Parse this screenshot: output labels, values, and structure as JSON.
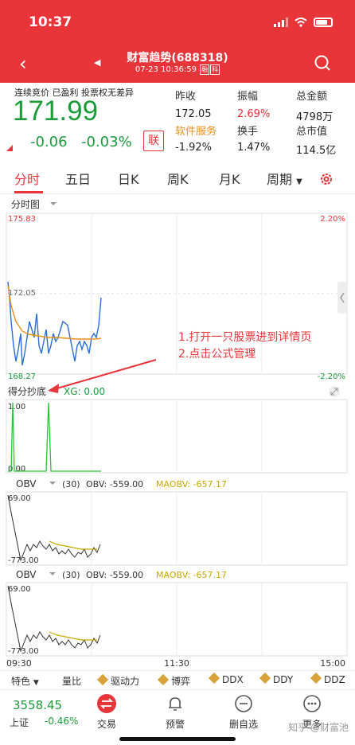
{
  "status_bar": {
    "time": "10:37"
  },
  "header": {
    "stock_name": "财富趋势",
    "stock_code": "(688318)",
    "datetime": "07-23 10:36:59",
    "tags": [
      "融",
      "科"
    ]
  },
  "quote": {
    "status_text": "连续竞价 已盈利 投票权无差异",
    "price": "171.99",
    "change": "-0.06",
    "change_pct": "-0.03%",
    "lian_label": "联",
    "fields": [
      {
        "label": "昨收",
        "value": "172.05"
      },
      {
        "label": "振幅",
        "value": "2.69%"
      },
      {
        "label": "总金额",
        "value": "4798万"
      },
      {
        "label": "软件服务",
        "value": "-1.92%"
      },
      {
        "label": "换手",
        "value": "1.47%"
      },
      {
        "label": "总市值",
        "value": "114.5亿"
      }
    ]
  },
  "tabs": [
    "分时",
    "五日",
    "日K",
    "周K",
    "月K",
    "周期"
  ],
  "chart": {
    "subtitle": "分时图",
    "y_max": "175.83",
    "y_mid": "172.05",
    "y_min": "168.27",
    "pct_max": "2.20%",
    "pct_min": "-2.20%",
    "annotation_line1": "1.打开一只股票进到详情页",
    "annotation_line2": "2.点击公式管理",
    "indicator1": {
      "name": "得分抄底",
      "xg": "XG: 0.00",
      "y_top": "1.00",
      "y_bottom": "0.00"
    },
    "obv1": {
      "name": "OBV",
      "params": "(30)",
      "obv": "OBV: -559.00",
      "maobv": "MAOBV: -657.17",
      "y_top": "69.00",
      "y_bottom": "-773.00"
    },
    "obv2": {
      "name": "OBV",
      "params": "(30)",
      "obv": "OBV: -559.00",
      "maobv": "MAOBV: -657.17",
      "y_top": "69.00",
      "y_bottom": "-773.00"
    },
    "x_start": "09:30",
    "x_mid": "11:30",
    "x_end": "15:00"
  },
  "indicator_bar": {
    "items": [
      "特色",
      "量比",
      "驱动力",
      "博弈",
      "DDX",
      "DDY",
      "DDZ"
    ]
  },
  "bottom": {
    "index_value": "3558.45",
    "index_name": "上证",
    "index_pct": "-0.46%",
    "nav": [
      "交易",
      "预警",
      "删自选",
      "更多"
    ],
    "watermark": "知乎 @财富池"
  },
  "colors": {
    "red": "#e8353a",
    "green": "#1a9c3a",
    "orange": "#e8911a",
    "blue": "#2a6fdb"
  }
}
